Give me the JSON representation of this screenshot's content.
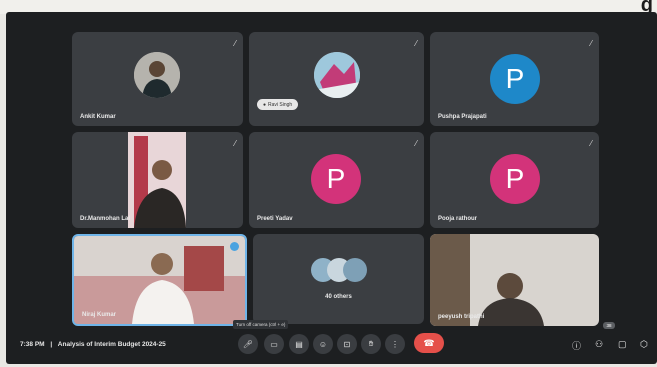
{
  "header": {
    "partial_text": "g"
  },
  "tiles": [
    {
      "name": "Ankit Kumar",
      "avatar": "photo"
    },
    {
      "name": "",
      "avatar": "photo",
      "pill": "Ravi Singh"
    },
    {
      "name": "Pushpa Prajapati",
      "avatar": "letter",
      "initial": "P",
      "color": "#1e88c9"
    },
    {
      "name": "Dr.Manmohan Lal",
      "avatar": "video"
    },
    {
      "name": "Preeti Yadav",
      "avatar": "letter",
      "initial": "P",
      "color": "#d3337a"
    },
    {
      "name": "Pooja rathour",
      "avatar": "letter",
      "initial": "P",
      "color": "#d3337a"
    },
    {
      "name": "Niraj Kumar",
      "avatar": "video"
    },
    {
      "name": "40 others",
      "avatar": "group"
    },
    {
      "name": "peeyush tripathi",
      "avatar": "video"
    }
  ],
  "bottom_bar": {
    "time": "7:38 PM",
    "separator": "|",
    "meeting_title": "Analysis of Interim Budget 2024-25",
    "tooltip": "Turn off camera (ctrl + e)",
    "badge": "38"
  },
  "icons": {
    "mic": "microphone-icon",
    "camera": "camera-icon",
    "captions": "captions-icon",
    "emoji": "emoji-icon",
    "present": "present-screen-icon",
    "hand": "raise-hand-icon",
    "more": "more-options-icon",
    "end": "end-call-icon",
    "info": "info-icon",
    "people": "people-icon",
    "chat": "chat-icon",
    "activities": "activities-icon"
  }
}
